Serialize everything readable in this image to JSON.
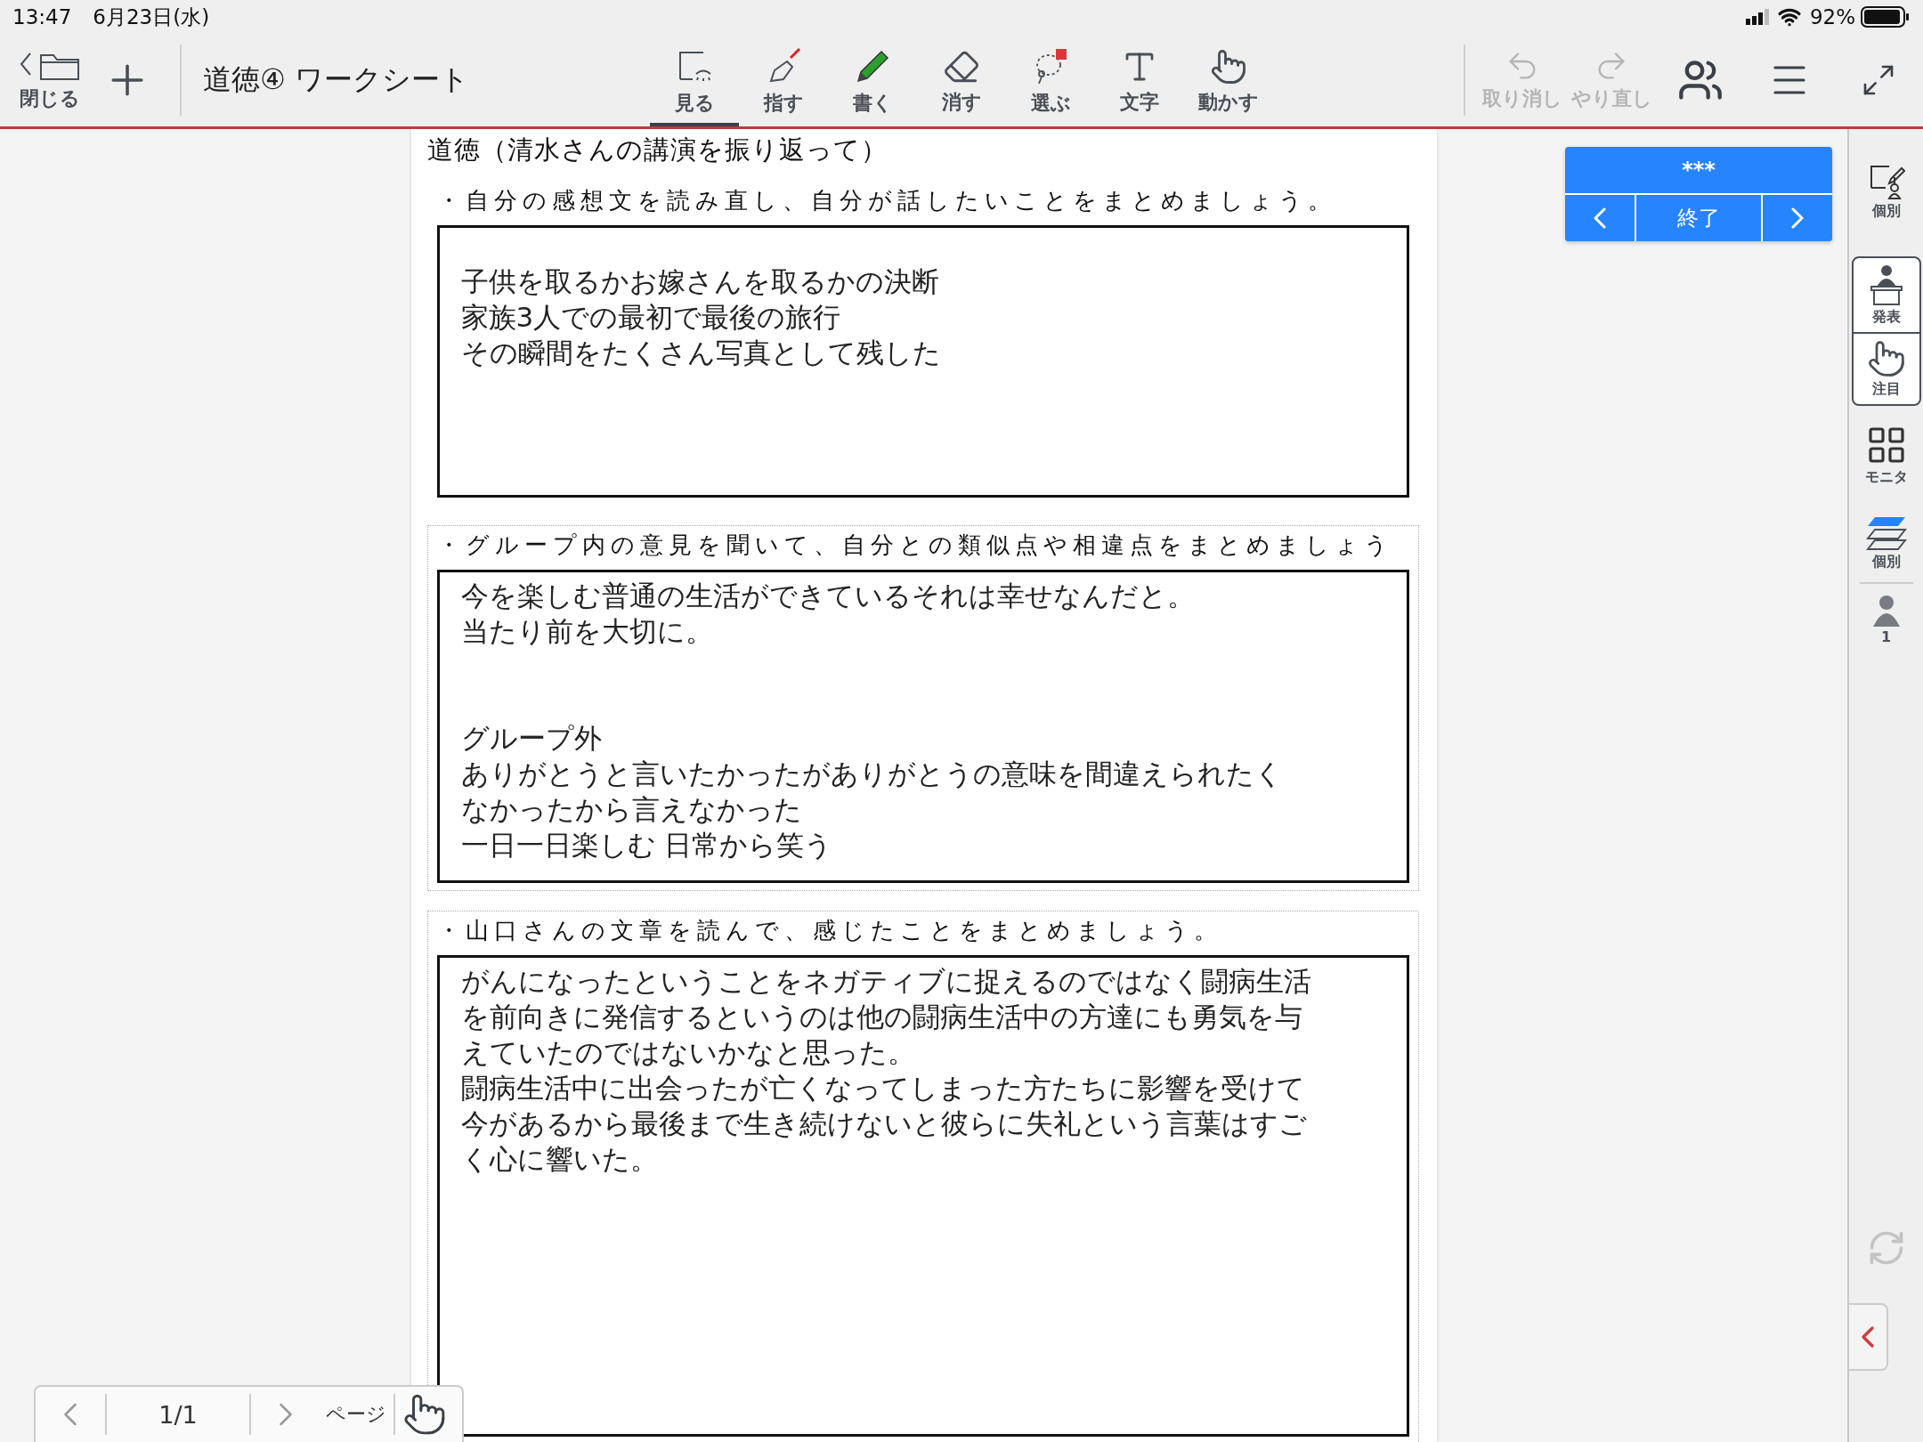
{
  "status_bar": {
    "time": "13:47",
    "date": "6月23日(水)",
    "battery": "92%"
  },
  "toolbar": {
    "back_label": "閉じる",
    "title": "道徳④ ワークシート",
    "tools": [
      {
        "kind": "view",
        "label": "見る",
        "selected": true
      },
      {
        "kind": "point",
        "label": "指す",
        "selected": false
      },
      {
        "kind": "write",
        "label": "書く",
        "selected": false
      },
      {
        "kind": "erase",
        "label": "消す",
        "selected": false
      },
      {
        "kind": "select",
        "label": "選ぶ",
        "selected": false
      },
      {
        "kind": "text",
        "label": "文字",
        "selected": false
      },
      {
        "kind": "move",
        "label": "動かす",
        "selected": false
      }
    ],
    "undo": {
      "label": "取り消し",
      "disabled": true
    },
    "redo": {
      "label": "やり直し",
      "disabled": true
    }
  },
  "worksheet": {
    "title": "道徳（清水さんの講演を振り返って）",
    "sections": [
      {
        "prompt": "・自分の感想文を読み直し、自分が話したいことをまとめましょう。",
        "framed": false,
        "paragraphs": [
          [
            "子供を取るかお嫁さんを取るかの決断",
            "家族3人での最初で最後の旅行",
            "その瞬間をたくさん写真として残した"
          ]
        ]
      },
      {
        "prompt": "・グループ内の意見を聞いて、自分との類似点や相違点をまとめましょう",
        "framed": true,
        "paragraphs": [
          [
            "今を楽しむ普通の生活ができているそれは幸せなんだと。",
            "当たり前を大切に。"
          ],
          [
            "グループ外",
            "ありがとうと言いたかったがありがとうの意味を間違えられたく",
            "なかったから言えなかった",
            "一日一日楽しむ 日常から笑う"
          ]
        ]
      },
      {
        "prompt": "・山口さんの文章を読んで、感じたことをまとめましょう。",
        "framed": true,
        "paragraphs": [
          [
            "がんになったということをネガティブに捉えるのではなく闘病生活",
            "を前向きに発信するというのは他の闘病生活中の方達にも勇気を与",
            "えていたのではないかなと思った。",
            "闘病生活中に出会ったが亡くなってしまった方たちに影響を受けて",
            "今があるから最後まで生き続けないと彼らに失礼という言葉はすご",
            "く心に響いた。"
          ]
        ]
      }
    ]
  },
  "session_panel": {
    "title": "***",
    "end_label": "終了"
  },
  "sidebar": {
    "items": [
      {
        "kind": "individual",
        "label": "個別"
      },
      {
        "kind": "present",
        "label": "発表"
      },
      {
        "kind": "attention",
        "label": "注目"
      },
      {
        "kind": "monitor",
        "label": "モニタ"
      },
      {
        "kind": "layers",
        "label": "個別"
      },
      {
        "kind": "user",
        "label": "1"
      }
    ]
  },
  "page_nav": {
    "page": "1/1",
    "label": "ページ"
  }
}
